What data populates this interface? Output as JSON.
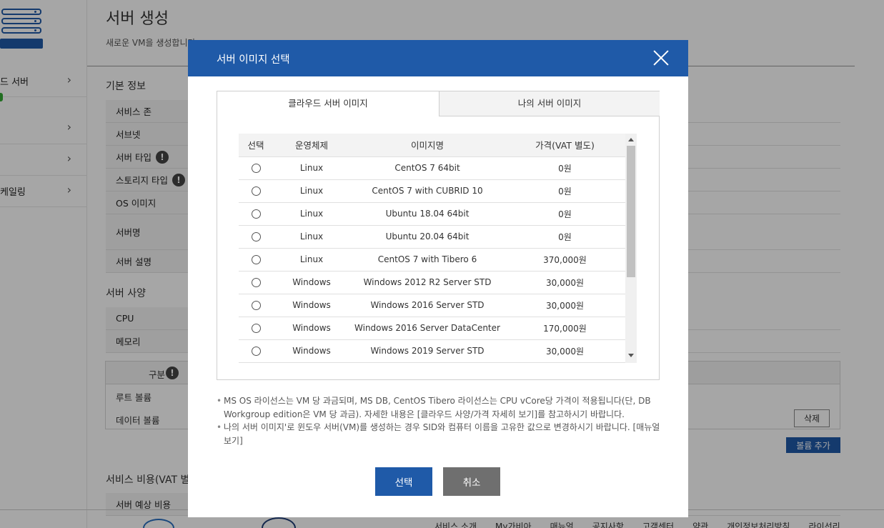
{
  "background": {
    "page_title": "서버 생성",
    "page_subtitle": "새로운 VM을 생성합니다.",
    "sidebar_items": [
      {
        "label": "드 서버"
      },
      {
        "label": ""
      },
      {
        "label": ""
      },
      {
        "label": "케일링"
      }
    ],
    "section_basic": "기본 정보",
    "basic_rows": [
      "서비스 존",
      "서브넷",
      "서버 타입",
      "스토리지 타입",
      "OS 이미지",
      "서버명",
      "서버 설명"
    ],
    "section_spec": "서버 사양",
    "spec_rows": [
      "CPU",
      "메모리"
    ],
    "volume_header": "구분",
    "volume_rows": [
      "루트 볼륨",
      "데이터 볼륨"
    ],
    "delete_label": "삭제",
    "add_volume_label": "볼륨 추가",
    "section_cost": "서비스 비용(VAT 별",
    "cost_row": "서버 예상 비용",
    "footer_links": [
      "서비스 소개",
      "My가비아",
      "매뉴얼",
      "공지사항",
      "고객센터",
      "약관",
      "개인정보처리방침",
      "라이선리"
    ]
  },
  "modal": {
    "title": "서버 이미지 선택",
    "tabs": [
      {
        "label": "클라우드 서버 이미지",
        "active": true
      },
      {
        "label": "나의 서버 이미지",
        "active": false
      }
    ],
    "columns": [
      "선택",
      "운영체제",
      "이미지명",
      "가격(VAT 별도)"
    ],
    "rows": [
      {
        "os": "Linux",
        "name": "CentOS 7 64bit",
        "price": "0원"
      },
      {
        "os": "Linux",
        "name": "CentOS 7 with CUBRID 10",
        "price": "0원"
      },
      {
        "os": "Linux",
        "name": "Ubuntu 18.04 64bit",
        "price": "0원"
      },
      {
        "os": "Linux",
        "name": "Ubuntu 20.04 64bit",
        "price": "0원"
      },
      {
        "os": "Linux",
        "name": "CentOS 7 with Tibero 6",
        "price": "370,000원"
      },
      {
        "os": "Windows",
        "name": "Windows 2012 R2 Server STD",
        "price": "30,000원"
      },
      {
        "os": "Windows",
        "name": "Windows 2016 Server STD",
        "price": "30,000원"
      },
      {
        "os": "Windows",
        "name": "Windows 2016 Server DataCenter",
        "price": "170,000원"
      },
      {
        "os": "Windows",
        "name": "Windows 2019 Server STD",
        "price": "30,000원"
      }
    ],
    "notes": [
      "MS OS 라이선스는 VM 당 과금되며, MS DB, CentOS Tibero 라이선스는 CPU vCore당 가격이 적용됩니다(단, DB Workgroup edition은 VM 당 과금). 자세한 내용은 [클라우드 사양/가격 자세히 보기]를 참고하시기 바랍니다.",
      "나의 서버 이미지'로 윈도우 서버(VM)를 생성하는 경우 SID와 컴퓨터 이름을 고유한 값으로 변경하시기 바랍니다. [매뉴얼 보기]"
    ],
    "select_label": "선택",
    "cancel_label": "취소"
  },
  "colors": {
    "accent": "#1f5aa8",
    "cancel": "#6f6f6f"
  }
}
